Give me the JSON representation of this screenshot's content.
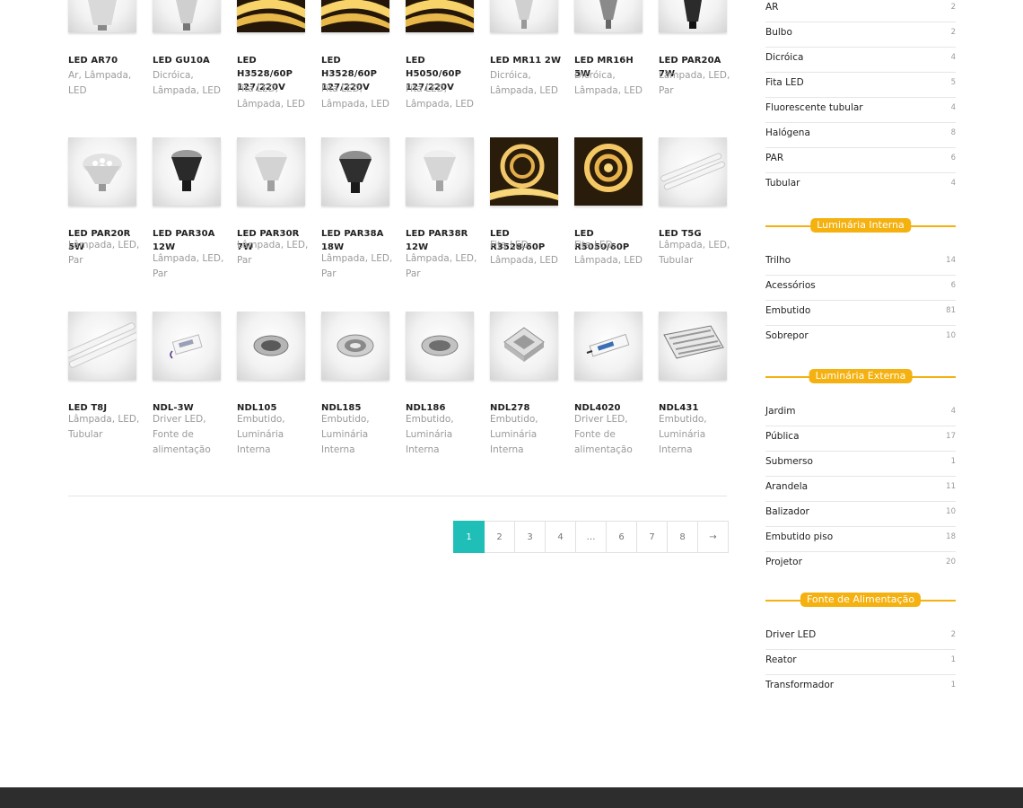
{
  "products": {
    "row1": [
      {
        "name": "LED AR70",
        "categories": "Ar, Lâmpada, LED",
        "icon": "led-ar70-bulb-icon"
      },
      {
        "name": "LED GU10A",
        "categories": "Dicróica, Lâmpada, LED",
        "icon": "led-gu10-bulb-icon"
      },
      {
        "name": "LED H3528/60P 127/220V",
        "categories": "Fita LED, Lâmpada, LED",
        "icon": "led-strip-icon"
      },
      {
        "name": "LED H3528/60P 127/220V",
        "categories": "Fita LED, Lâmpada, LED",
        "icon": "led-strip-icon"
      },
      {
        "name": "LED H5050/60P 127/220V",
        "categories": "Fita LED, Lâmpada, LED",
        "icon": "led-strip-icon"
      },
      {
        "name": "LED MR11 2W",
        "categories": "Dicróica, Lâmpada, LED",
        "icon": "led-mr11-bulb-icon"
      },
      {
        "name": "LED MR16H 5W",
        "categories": "Dicróica, Lâmpada, LED",
        "icon": "led-mr16-bulb-icon"
      },
      {
        "name": "LED PAR20A 7W",
        "categories": "Lâmpada, LED, Par",
        "icon": "led-par20-bulb-icon"
      }
    ],
    "row2": [
      {
        "name": "LED PAR20R 5W",
        "categories": "Lâmpada, LED, Par",
        "icon": "led-par-bulb-icon"
      },
      {
        "name": "LED PAR30A 12W",
        "categories": "Lâmpada, LED, Par",
        "icon": "led-par-bulb-icon"
      },
      {
        "name": "LED PAR30R 7W",
        "categories": "Lâmpada, LED, Par",
        "icon": "led-par-bulb-icon"
      },
      {
        "name": "LED PAR38A 18W",
        "categories": "Lâmpada, LED, Par",
        "icon": "led-par-bulb-icon"
      },
      {
        "name": "LED PAR38R 12W",
        "categories": "Lâmpada, LED, Par",
        "icon": "led-par-bulb-icon"
      },
      {
        "name": "LED R3528/60P",
        "categories": "Fita LED, Lâmpada, LED",
        "icon": "led-strip-reel-icon"
      },
      {
        "name": "LED R5050/60P",
        "categories": "Fita LED, Lâmpada, LED",
        "icon": "led-strip-reel-icon"
      },
      {
        "name": "LED T5G",
        "categories": "Lâmpada, LED, Tubular",
        "icon": "led-tube-icon"
      }
    ],
    "row3": [
      {
        "name": "LED T8J",
        "categories": "Lâmpada, LED, Tubular",
        "icon": "led-tube-icon"
      },
      {
        "name": "NDL-3W",
        "categories": "Driver LED, Fonte de alimentação",
        "icon": "led-driver-icon"
      },
      {
        "name": "NDL105",
        "categories": "Embutido, Luminária Interna",
        "icon": "recessed-downlight-icon"
      },
      {
        "name": "NDL185",
        "categories": "Embutido, Luminária Interna",
        "icon": "recessed-downlight-icon"
      },
      {
        "name": "NDL186",
        "categories": "Embutido, Luminária Interna",
        "icon": "recessed-downlight-icon"
      },
      {
        "name": "NDL278",
        "categories": "Embutido, Luminária Interna",
        "icon": "square-downlight-icon"
      },
      {
        "name": "NDL4020",
        "categories": "Driver LED, Fonte de alimentação",
        "icon": "led-driver-icon"
      },
      {
        "name": "NDL431",
        "categories": "Embutido, Luminária Interna",
        "icon": "louver-luminaire-icon"
      }
    ]
  },
  "pagination": {
    "pages": [
      "1",
      "2",
      "3",
      "4",
      "…",
      "6",
      "7",
      "8"
    ],
    "current": "1",
    "next_label": "→"
  },
  "sidebar": {
    "lampadas": [
      {
        "label": "AR",
        "count": "2"
      },
      {
        "label": "Bulbo",
        "count": "2"
      },
      {
        "label": "Dicróica",
        "count": "4"
      },
      {
        "label": "Fita LED",
        "count": "5"
      },
      {
        "label": "Fluorescente tubular",
        "count": "4"
      },
      {
        "label": "Halógena",
        "count": "8"
      },
      {
        "label": "PAR",
        "count": "6"
      },
      {
        "label": "Tubular",
        "count": "4"
      }
    ],
    "luminaria_interna": {
      "title": "Luminária Interna",
      "items": [
        {
          "label": "Trilho",
          "count": "14"
        },
        {
          "label": "Acessórios",
          "count": "6"
        },
        {
          "label": "Embutido",
          "count": "81"
        },
        {
          "label": "Sobrepor",
          "count": "10"
        }
      ]
    },
    "luminaria_externa": {
      "title": "Luminária Externa",
      "items": [
        {
          "label": "Jardim",
          "count": "4"
        },
        {
          "label": "Pública",
          "count": "17"
        },
        {
          "label": "Submerso",
          "count": "1"
        },
        {
          "label": "Arandela",
          "count": "11"
        },
        {
          "label": "Balizador",
          "count": "10"
        },
        {
          "label": "Embutido piso",
          "count": "18"
        },
        {
          "label": "Projetor",
          "count": "20"
        }
      ]
    },
    "fonte_alimentacao": {
      "title": "Fonte de Alimentação",
      "items": [
        {
          "label": "Driver LED",
          "count": "2"
        },
        {
          "label": "Reator",
          "count": "1"
        },
        {
          "label": "Transformador",
          "count": "1"
        }
      ]
    }
  },
  "colors": {
    "accent_teal": "#1fbfb8",
    "accent_amber": "#f4b10f",
    "footer_bg": "#2d2d2d"
  }
}
